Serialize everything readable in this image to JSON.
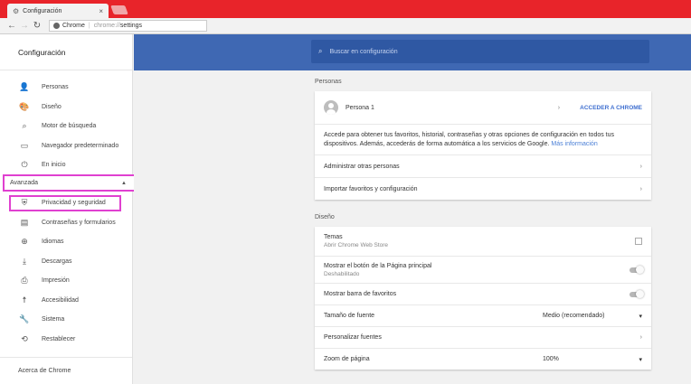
{
  "window": {
    "tab_title": "Configuración",
    "omnibox": {
      "brand": "Chrome",
      "separator": "|",
      "scheme": "chrome://",
      "path": "settings"
    }
  },
  "sidebar": {
    "title": "Configuración",
    "items": [
      {
        "label": "Personas",
        "icon": "person-icon"
      },
      {
        "label": "Diseño",
        "icon": "palette-icon"
      },
      {
        "label": "Motor de búsqueda",
        "icon": "search-icon"
      },
      {
        "label": "Navegador predeterminado",
        "icon": "browser-icon"
      },
      {
        "label": "En inicio",
        "icon": "power-icon"
      }
    ],
    "advanced_label": "Avanzada",
    "advanced_items": [
      {
        "label": "Privacidad y seguridad",
        "icon": "shield-icon"
      },
      {
        "label": "Contraseñas y formularios",
        "icon": "clipboard-icon"
      },
      {
        "label": "Idiomas",
        "icon": "globe-icon"
      },
      {
        "label": "Descargas",
        "icon": "download-icon"
      },
      {
        "label": "Impresión",
        "icon": "printer-icon"
      },
      {
        "label": "Accesibilidad",
        "icon": "accessibility-icon"
      },
      {
        "label": "Sistema",
        "icon": "wrench-icon"
      },
      {
        "label": "Restablecer",
        "icon": "restore-icon"
      }
    ],
    "about_label": "Acerca de Chrome"
  },
  "search": {
    "placeholder": "Buscar en configuración"
  },
  "people": {
    "section_title": "Personas",
    "profile_name": "Persona 1",
    "signin_label": "ACCEDER A CHROME",
    "description": "Accede para obtener tus favoritos, historial, contraseñas y otras opciones de configuración en todos tus dispositivos. Además, accederás de forma automática a los servicios de Google.",
    "more_info": "Más información",
    "manage_label": "Administrar otras personas",
    "import_label": "Importar favoritos y configuración"
  },
  "appearance": {
    "section_title": "Diseño",
    "themes_label": "Temas",
    "themes_sub": "Abrir Chrome Web Store",
    "home_button_label": "Mostrar el botón de la Página principal",
    "home_button_sub": "Deshabilitado",
    "bookmarks_bar_label": "Mostrar barra de favoritos",
    "font_size_label": "Tamaño de fuente",
    "font_size_value": "Medio (recomendado)",
    "customize_fonts_label": "Personalizar fuentes",
    "zoom_label": "Zoom de página",
    "zoom_value": "100%"
  }
}
